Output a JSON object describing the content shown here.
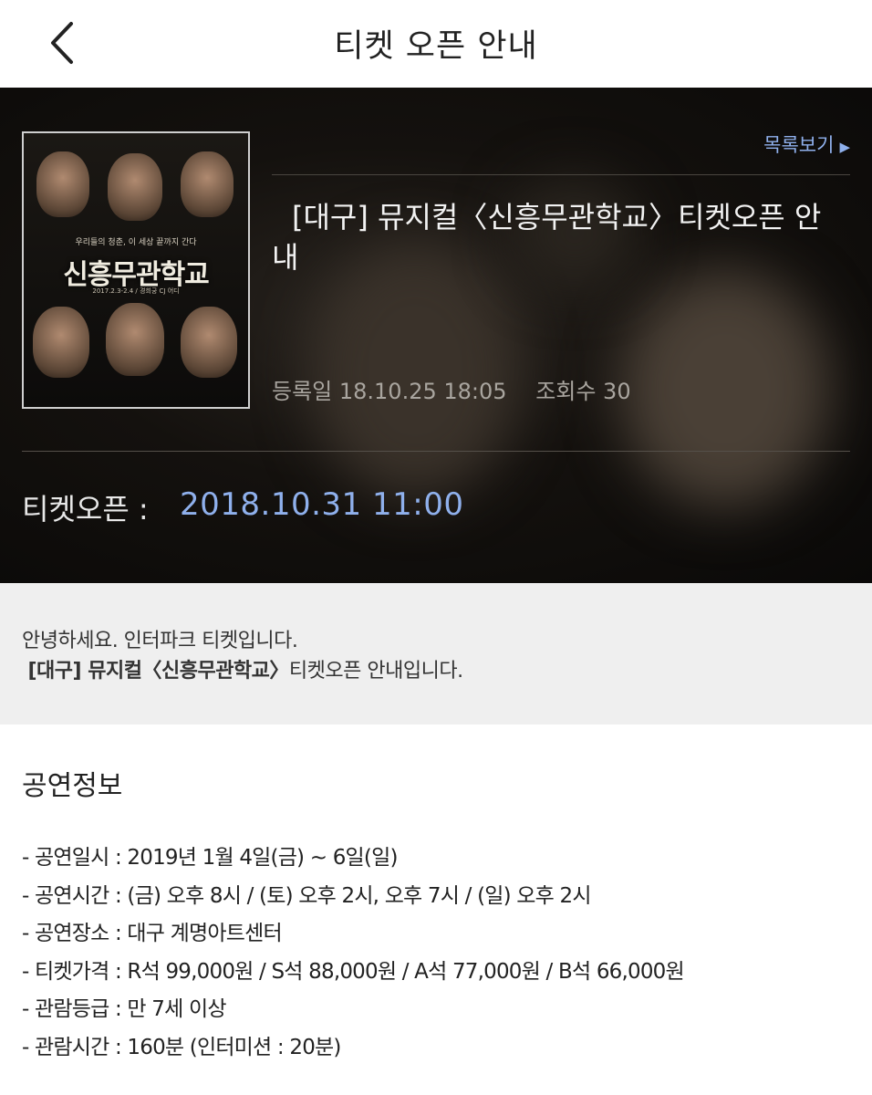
{
  "header": {
    "title": "티켓 오픈 안내",
    "back_icon": "chevron-left-icon"
  },
  "hero": {
    "list_link_label": "목록보기",
    "list_link_icon": "triangle-right-icon",
    "notice_title": "[대구] 뮤지컬〈신흥무관학교〉티켓오픈 안내",
    "registered_label": "등록일 18.10.25 18:05",
    "views_label": "조회수 30",
    "ticket_open_label": "티켓오픈 :",
    "ticket_open_date": "2018.10.31 11:00",
    "accent_color": "#8fb0ec",
    "poster": {
      "title": "신흥무관학교",
      "subtitle": "우리들의 청춘, 이 세상 끝까지 간다",
      "date_line": "2017.2.3-2.4 / 경희궁 CJ 어디"
    }
  },
  "greeting": {
    "line1": "안녕하세요. 인터파크 티켓입니다.",
    "line2_bold": "[대구] 뮤지컬〈신흥무관학교〉",
    "line2_rest": "티켓오픈 안내입니다."
  },
  "info": {
    "heading": "공연정보",
    "items": [
      "- 공연일시 : 2019년 1월 4일(금) ~ 6일(일)",
      "- 공연시간 : (금) 오후 8시 / (토) 오후 2시, 오후 7시 / (일) 오후 2시",
      "- 공연장소 : 대구 계명아트센터",
      "- 티켓가격 : R석 99,000원 / S석 88,000원 / A석 77,000원 / B석 66,000원",
      "- 관람등급 : 만 7세 이상",
      "- 관람시간 : 160분 (인터미션 : 20분)"
    ]
  }
}
